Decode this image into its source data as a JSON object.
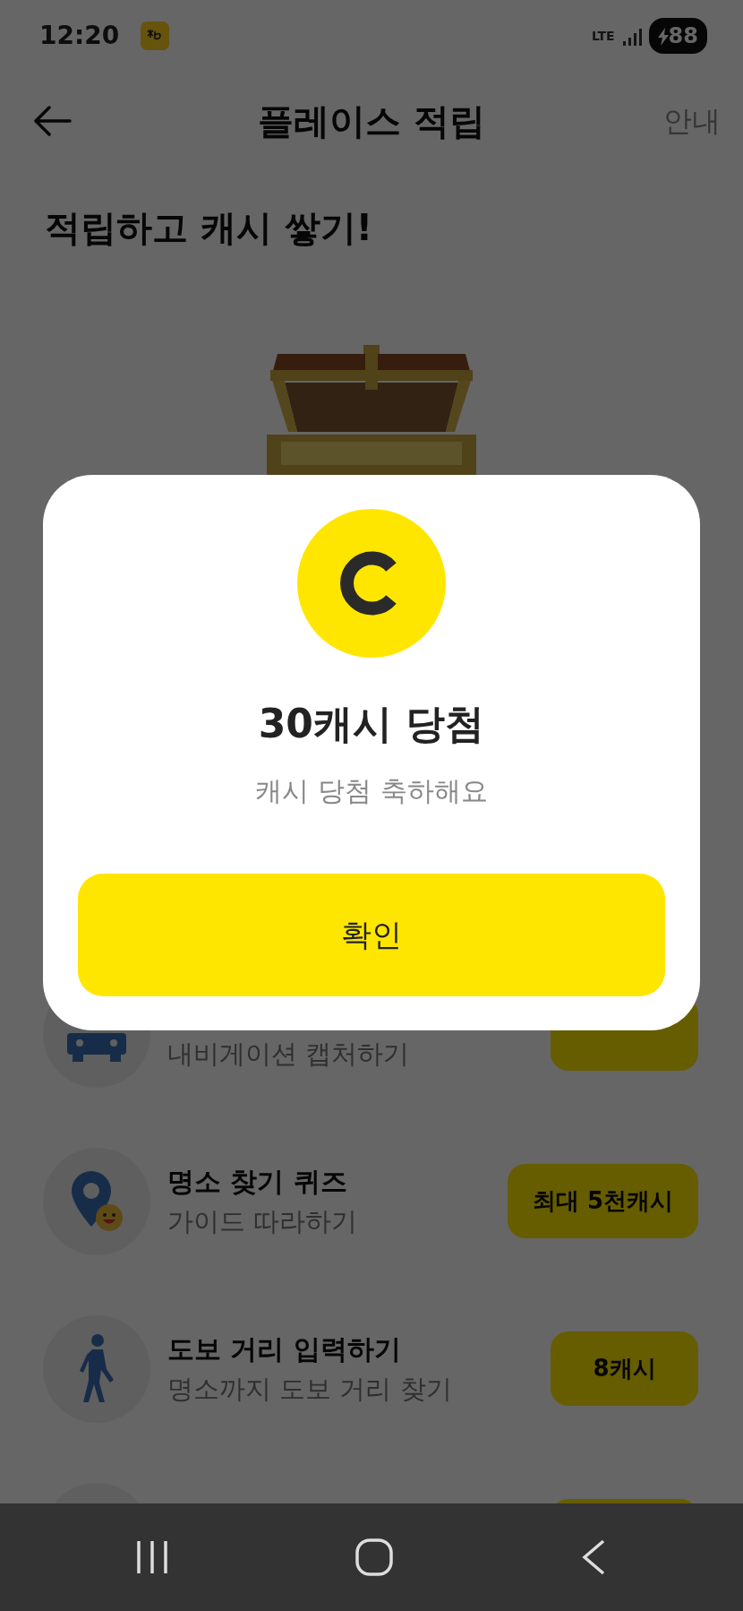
{
  "status_bar": {
    "time": "12:20",
    "network": "LTE",
    "battery": "88"
  },
  "header": {
    "title": "플레이스 적립",
    "action": "안내"
  },
  "heading": "적립하고 캐시 쌓기!",
  "missions": [
    {
      "kind": "car",
      "subtitle": "내비게이션 캡처하기"
    },
    {
      "kind": "pin",
      "title": "명소 찾기 퀴즈",
      "subtitle": "가이드 따라하기",
      "reward": "최대 5천캐시"
    },
    {
      "kind": "walk",
      "title": "도보 거리 입력하기",
      "subtitle": "명소까지 도보 거리 찾기",
      "reward": "8캐시"
    },
    {
      "kind": "hidden"
    }
  ],
  "dialog": {
    "title": "30캐시 당첨",
    "message": "캐시 당첨 축하해요",
    "button": "확인"
  }
}
